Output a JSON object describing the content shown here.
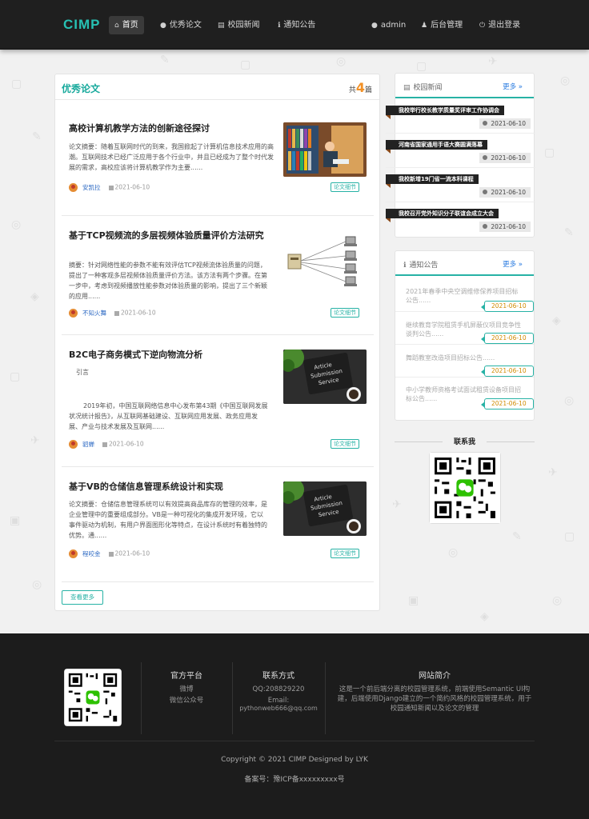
{
  "header": {
    "logo": "CIMP",
    "nav": [
      {
        "icon": "home-icon",
        "label": "首页"
      },
      {
        "icon": "lightbulb-icon",
        "label": "优秀论文"
      },
      {
        "icon": "newspaper-icon",
        "label": "校园新闻"
      },
      {
        "icon": "info-icon",
        "label": "通知公告"
      }
    ],
    "user": {
      "icon": "user-icon",
      "label": "admin"
    },
    "admin": {
      "icon": "users-icon",
      "label": "后台管理"
    },
    "logout": {
      "icon": "power-icon",
      "label": "退出登录"
    }
  },
  "papers": {
    "title": "优秀论文",
    "count_prefix": "共",
    "count": "4",
    "count_suffix": "篇",
    "more_label": "查看更多",
    "items": [
      {
        "title": "高校计算机教学方法的创新途径探讨",
        "abstract": "论文摘要：随着互联网时代的到来，我国掀起了计算机信息技术应用的高潮。互联网技术已经广泛应用于各个行业中，并且已经成为了整个时代发展的需求，高校应该将计算机教学作为主要......",
        "author": "安凯拉",
        "date": "2021-06-10",
        "tag": "论文细节",
        "thumb": "library-photo"
      },
      {
        "title": "基于TCP视频流的多层视频体验质量评价方法研究",
        "abstract": "摘要：针对网络性能的参数不能有效评估TCP视频流体验质量的问题，提出了一种客观多层视频体验质量评价方法。该方法有两个步骤。在第一步中，考虑到视频播放性能参数对体验质量的影响，提出了三个新颖的应用......",
        "author": "不知火舞",
        "date": "2021-06-10",
        "tag": "论文细节",
        "thumb": "network-diagram"
      },
      {
        "title": "B2C电子商务模式下逆向物流分析",
        "abstract_lines": [
          "引言",
          "2019年初，中国互联网络信息中心发布第43期《中国互联网发展状况统计报告》，从互联网基础建设、互联网应用发展、政务应用发展、产业与技术发展及互联网......"
        ],
        "author": "貂蝉",
        "date": "2021-06-10",
        "tag": "论文细节",
        "thumb": "article-submission"
      },
      {
        "title": "基于VB的仓储信息管理系统设计和实现",
        "abstract": "论文摘要：仓储信息管理系统可以有效提高商品库存的管理的效率，是企业管理中的重要组成部分。VB是一种可视化的集成开发环境，它以事件驱动为机制，有用户界面图形化等特点，在设计系统时有着独特的优势。通......",
        "author": "程咬金",
        "date": "2021-06-10",
        "tag": "论文细节",
        "thumb": "article-submission"
      }
    ],
    "thumb_text": [
      "Article",
      "Submission",
      "Service"
    ]
  },
  "news": {
    "title": "校园新闻",
    "more": "更多 »",
    "items": [
      {
        "title": "我校举行校长教学质量奖评审工作协调会",
        "date": "2021-06-10"
      },
      {
        "title": "河南省国家通用手语大赛圆满落幕",
        "date": "2021-06-10"
      },
      {
        "title": "我校新增19门省一流本科课程",
        "date": "2021-06-10"
      },
      {
        "title": "我校召开党外知识分子联谊会成立大会",
        "date": "2021-06-10"
      }
    ]
  },
  "notices": {
    "title": "通知公告",
    "more": "更多 »",
    "items": [
      {
        "title": "2021年春季中央空调维修保养项目招标公告......",
        "date": "2021-06-10"
      },
      {
        "title": "继续教育学院租赁手机屏蔽仪项目竞争性谈判公告......",
        "date": "2021-06-10"
      },
      {
        "title": "舞蹈教室改造项目招标公告......",
        "date": "2021-06-10"
      },
      {
        "title": "中小学教师资格考试面试租赁设备项目招标公告......",
        "date": "2021-06-10"
      }
    ]
  },
  "contact": {
    "title": "联系我"
  },
  "footer": {
    "platform_title": "官方平台",
    "platform_items": [
      "微博",
      "微信公众号"
    ],
    "contact_title": "联系方式",
    "qq": "QQ:208829220",
    "email_label": "Email:",
    "email": "pythonweb666@qq.com",
    "about_title": "网站简介",
    "about": "这是一个前后端分离的校园管理系统，前端使用Semantic UI构建，后端使用Django建立的一个简约风格的校园管理系统，用于校园通知新闻以及论文的管理",
    "copyright": "Copyright © 2021 CIMP Designed by LYK",
    "icp": "备案号：豫ICP备xxxxxxxxx号"
  },
  "colors": {
    "accent": "#27b2a5",
    "header_bg": "#1f1f1f",
    "footer_bg": "#1c1c1c",
    "count": "#f29126"
  }
}
